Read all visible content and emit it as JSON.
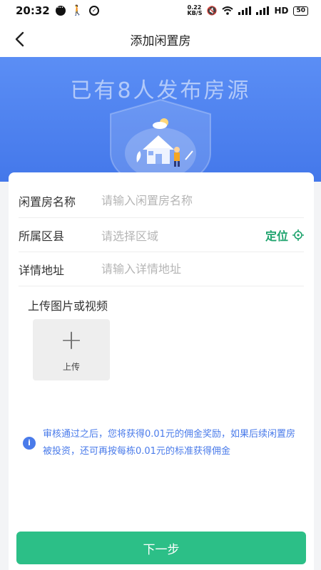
{
  "status_bar": {
    "time": "20:32",
    "network_speed": "0.22 KB/S",
    "hd_label": "HD",
    "battery": "50"
  },
  "nav": {
    "title": "添加闲置房"
  },
  "banner": {
    "text": "已有8人发布房源"
  },
  "form": {
    "name_label": "闲置房名称",
    "name_placeholder": "请输入闲置房名称",
    "district_label": "所属区县",
    "district_placeholder": "请选择区域",
    "locate_label": "定位",
    "address_label": "详情地址",
    "address_placeholder": "请输入详情地址",
    "upload_title": "上传图片或视频",
    "upload_label": "上传"
  },
  "notice": {
    "text": "审核通过之后，您将获得0.01元的佣金奖励，如果后续闲置房被投资，还可再按每栋0.01元的标准获得佣金"
  },
  "footer": {
    "next_label": "下一步"
  },
  "colors": {
    "primary_green": "#2cbf87",
    "banner_blue": "#4a7bea",
    "locate_green": "#1ea36d"
  }
}
